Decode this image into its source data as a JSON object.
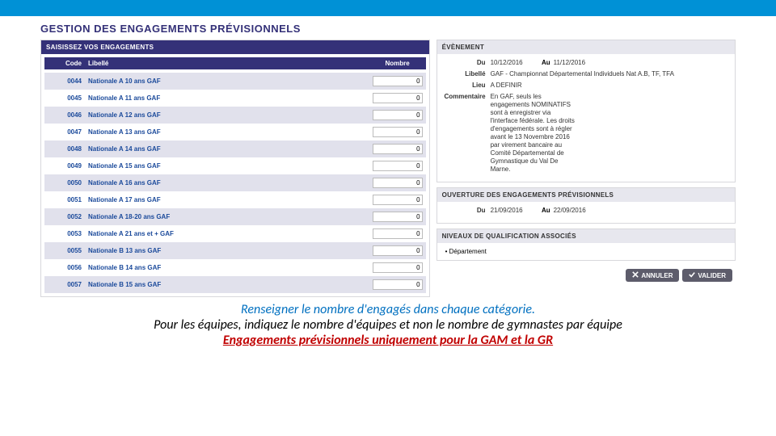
{
  "page_title": "GESTION DES ENGAGEMENTS PRÉVISIONNELS",
  "left_panel_header": "SAISISSEZ VOS ENGAGEMENTS",
  "table": {
    "headers": {
      "code": "Code",
      "libelle": "Libellé",
      "nombre": "Nombre"
    },
    "rows": [
      {
        "code": "0044",
        "lib": "Nationale A 10 ans GAF",
        "val": "0"
      },
      {
        "code": "0045",
        "lib": "Nationale A 11 ans GAF",
        "val": "0"
      },
      {
        "code": "0046",
        "lib": "Nationale A 12 ans GAF",
        "val": "0"
      },
      {
        "code": "0047",
        "lib": "Nationale A 13 ans GAF",
        "val": "0"
      },
      {
        "code": "0048",
        "lib": "Nationale A 14 ans GAF",
        "val": "0"
      },
      {
        "code": "0049",
        "lib": "Nationale A 15 ans GAF",
        "val": "0"
      },
      {
        "code": "0050",
        "lib": "Nationale A 16 ans GAF",
        "val": "0"
      },
      {
        "code": "0051",
        "lib": "Nationale A 17 ans GAF",
        "val": "0"
      },
      {
        "code": "0052",
        "lib": "Nationale A 18-20 ans GAF",
        "val": "0"
      },
      {
        "code": "0053",
        "lib": "Nationale A 21 ans et + GAF",
        "val": "0"
      },
      {
        "code": "0055",
        "lib": "Nationale B 13 ans GAF",
        "val": "0"
      },
      {
        "code": "0056",
        "lib": "Nationale B 14 ans GAF",
        "val": "0"
      },
      {
        "code": "0057",
        "lib": "Nationale B 15 ans GAF",
        "val": "0"
      }
    ]
  },
  "event": {
    "header": "ÉVÈNEMENT",
    "du_label": "Du",
    "du_val": "10/12/2016",
    "au_label": "Au",
    "au_val": "11/12/2016",
    "libelle_label": "Libellé",
    "libelle_val": "GAF - Championnat Départemental Individuels Nat A.B, TF, TFA",
    "lieu_label": "Lieu",
    "lieu_val": "A DEFINIR",
    "comment_label": "Commentaire",
    "comment_val": "En GAF, seuls les engagements NOMINATIFS sont à enregistrer via l'interface fédérale. Les droits d'engagements sont à régler avant le 13 Novembre 2016 par virement bancaire au Comité Départemental de Gymnastique du Val De Marne."
  },
  "ouverture": {
    "header": "OUVERTURE DES ENGAGEMENTS PRÉVISIONNELS",
    "du_label": "Du",
    "du_val": "21/09/2016",
    "au_label": "Au",
    "au_val": "22/09/2016"
  },
  "niveaux": {
    "header": "NIVEAUX DE QUALIFICATION ASSOCIÉS",
    "item": "Département"
  },
  "buttons": {
    "annuler": "ANNULER",
    "valider": "VALIDER"
  },
  "caption": {
    "l1": "Renseigner le nombre d'engagés dans chaque catégorie.",
    "l2": "Pour les équipes, indiquez le nombre d'équipes et non le nombre de gymnastes par équipe",
    "l3": "Engagements prévisionnels uniquement pour la GAM et la GR"
  }
}
